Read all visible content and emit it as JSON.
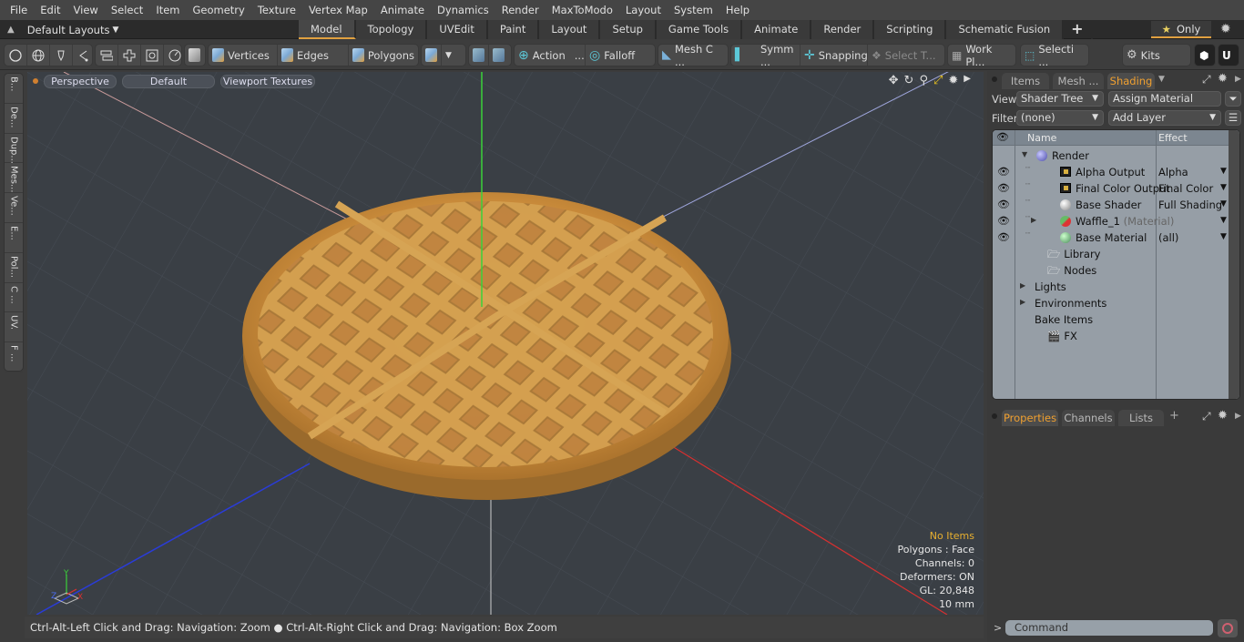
{
  "menu": [
    "File",
    "Edit",
    "View",
    "Select",
    "Item",
    "Geometry",
    "Texture",
    "Vertex Map",
    "Animate",
    "Dynamics",
    "Render",
    "MaxToModo",
    "Layout",
    "System",
    "Help"
  ],
  "layouts": {
    "label": "Default Layouts",
    "icon": "up-arrow-icon"
  },
  "mode_tabs": [
    {
      "label": "Model",
      "active": true
    },
    {
      "label": "Topology"
    },
    {
      "label": "UVEdit"
    },
    {
      "label": "Paint"
    },
    {
      "label": "Layout"
    },
    {
      "label": "Setup"
    },
    {
      "label": "Game Tools"
    },
    {
      "label": "Animate"
    },
    {
      "label": "Render"
    },
    {
      "label": "Scripting"
    },
    {
      "label": "Schematic Fusion"
    }
  ],
  "add_tab": "+",
  "only_button": {
    "label": "Only",
    "icon": "star-icon"
  },
  "toolbar": {
    "vertices": "Vertices",
    "edges": "Edges",
    "polygons": "Polygons",
    "action": "Action",
    "action_more": "...",
    "falloff": "Falloff",
    "mesh_c": "Mesh C ...",
    "symm": "Symm ...",
    "snapping": "Snapping",
    "select_t": "Select T...",
    "work_pl": "Work Pl...",
    "selecti": "Selecti ...",
    "kits": "Kits"
  },
  "left_tabs": [
    "B...",
    "De...",
    "Dup...",
    "Mes...",
    "Ve...",
    "E...",
    "Pol...",
    "C ...",
    "UV.",
    "F ..."
  ],
  "viewport": {
    "view": "Perspective",
    "style": "Default",
    "textures": "Viewport Textures",
    "hud": {
      "selection": "No Items",
      "polygons": "Polygons : Face",
      "channels": "Channels: 0",
      "deformers": "Deformers: ON",
      "gl": "GL: 20,848",
      "unit": "10 mm"
    },
    "axis": {
      "y": "Y",
      "x": "X",
      "z": "Z"
    }
  },
  "status": {
    "text": "Ctrl-Alt-Left Click and Drag: Navigation: Zoom ● Ctrl-Alt-Right Click and Drag: Navigation: Box Zoom"
  },
  "right_panel": {
    "tabs": [
      {
        "label": "Items"
      },
      {
        "label": "Mesh ..."
      },
      {
        "label": "Shading",
        "active": true
      }
    ],
    "view_label": "View",
    "view_value": "Shader Tree",
    "assign_material": "Assign Material",
    "filter_label": "Filter",
    "filter_value": "(none)",
    "add_layer": "Add Layer",
    "columns": {
      "name": "Name",
      "effect": "Effect"
    },
    "tree": [
      {
        "name": "Render",
        "effect": "",
        "icon": "render-sphere-icon",
        "eye": false,
        "indent": 0,
        "expander": "▼"
      },
      {
        "name": "Alpha Output",
        "effect": "Alpha",
        "icon": "output-icon",
        "eye": true,
        "indent": 1
      },
      {
        "name": "Final Color Output",
        "effect": "Final Color",
        "icon": "output-icon",
        "eye": true,
        "indent": 1
      },
      {
        "name": "Base Shader",
        "effect": "Full Shading",
        "icon": "shader-sphere-icon",
        "eye": true,
        "indent": 1
      },
      {
        "name": "Waffle_1",
        "suffix": "(Material)",
        "effect": "",
        "icon": "material-sphere-icon",
        "eye": true,
        "indent": 1,
        "expander": "▶"
      },
      {
        "name": "Base Material",
        "effect": "(all)",
        "icon": "base-material-icon",
        "eye": true,
        "indent": 1
      },
      {
        "name": "Library",
        "icon": "folder-icon",
        "indent": 2
      },
      {
        "name": "Nodes",
        "icon": "folder-icon",
        "indent": 2
      },
      {
        "name": "Lights",
        "indent": 3,
        "expander": "▶"
      },
      {
        "name": "Environments",
        "indent": 3,
        "expander": "▶"
      },
      {
        "name": "Bake Items",
        "indent": 3
      },
      {
        "name": "FX",
        "icon": "clapper-icon",
        "indent": 2
      }
    ],
    "bottom_tabs": [
      {
        "label": "Properties",
        "active": true
      },
      {
        "label": "Channels"
      },
      {
        "label": "Lists"
      }
    ],
    "command_placeholder": "Command"
  }
}
